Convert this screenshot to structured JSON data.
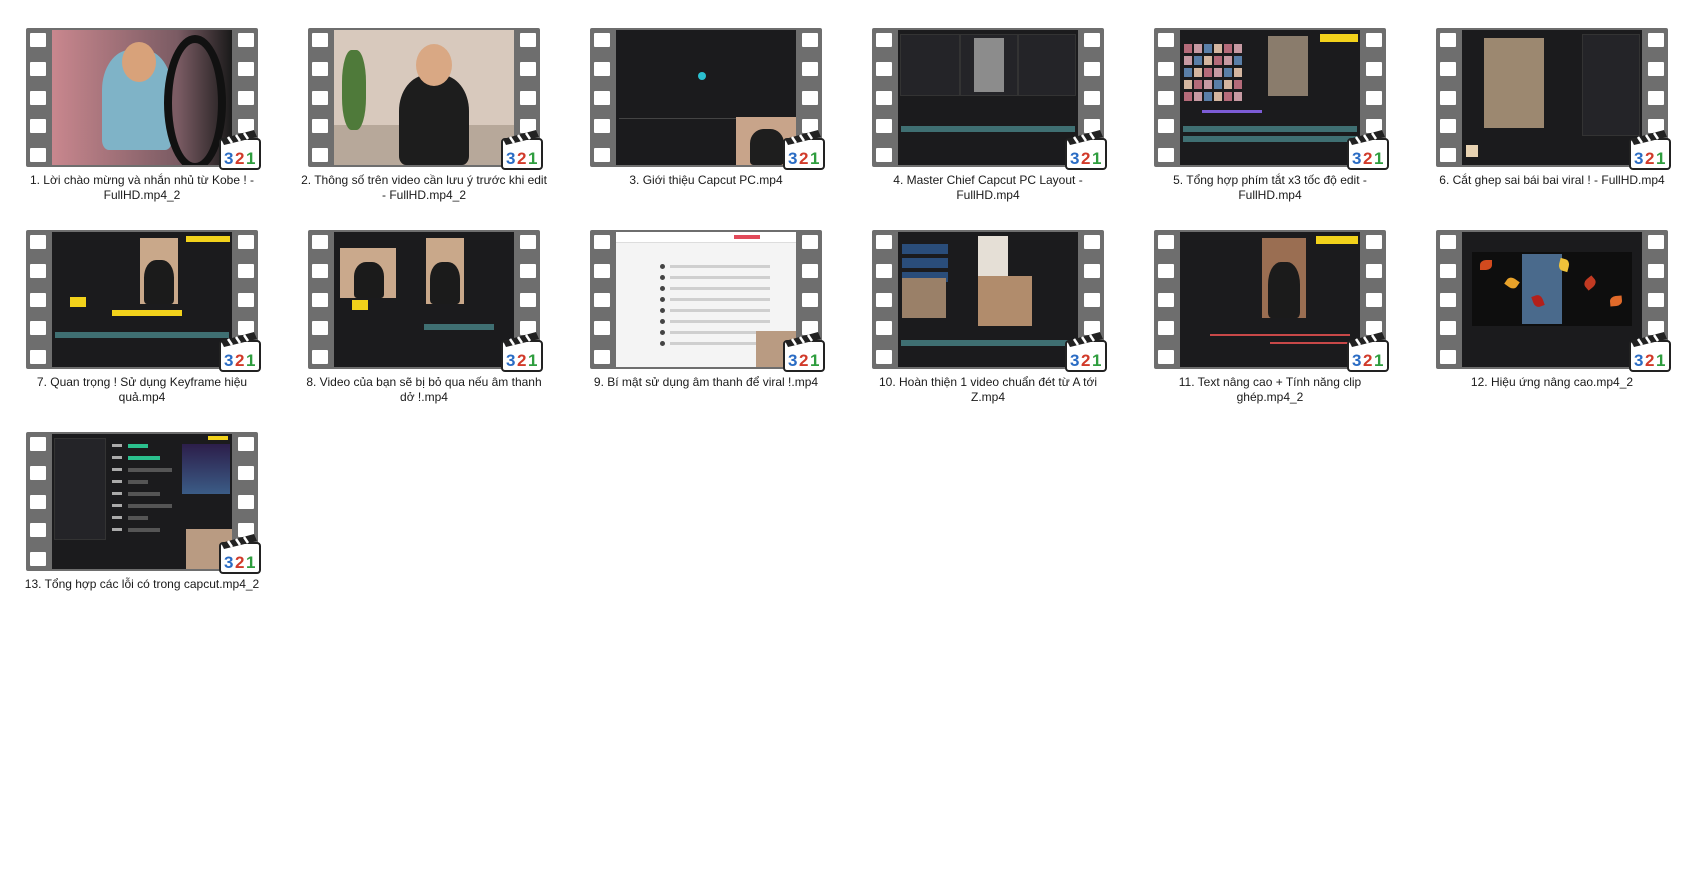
{
  "files": [
    {
      "name": "1. Lời chào mừng và nhắn nhủ từ Kobe ! - FullHD.mp4_2",
      "thumb": "vlog-pink",
      "badge": "321"
    },
    {
      "name": "2. Thông số trên video cần lưu ý trước khi edit - FullHD.mp4_2",
      "thumb": "vlog-room",
      "badge": "321"
    },
    {
      "name": "3. Giới thiệu Capcut PC.mp4",
      "thumb": "editor-empty",
      "badge": "321"
    },
    {
      "name": "4. Master Chief Capcut PC Layout - FullHD.mp4",
      "thumb": "editor-layout",
      "badge": "321"
    },
    {
      "name": "5. Tổng hợp phím tắt x3 tốc độ edit -FullHD.mp4",
      "thumb": "editor-grid",
      "badge": "321"
    },
    {
      "name": "6. Cắt ghep sai bái bai viral ! - FullHD.mp4",
      "thumb": "editor-crop",
      "badge": "321"
    },
    {
      "name": "7. Quan trọng ! Sử dụng Keyframe hiệu quả.mp4",
      "thumb": "editor-keyframe",
      "badge": "321"
    },
    {
      "name": "8. Video của bạn sẽ bị bỏ qua nếu âm thanh dở !.mp4",
      "thumb": "editor-two",
      "badge": "321"
    },
    {
      "name": "9. Bí mật sử dụng âm thanh để viral !.mp4",
      "thumb": "web-list",
      "badge": "321"
    },
    {
      "name": "10. Hoàn thiện 1 video chuẩn đét từ A tới Z.mp4",
      "thumb": "editor-full",
      "badge": "321"
    },
    {
      "name": "11. Text nâng cao + Tính năng clip ghép.mp4_2",
      "thumb": "editor-text",
      "badge": "321"
    },
    {
      "name": "12. Hiệu ứng nâng cao.mp4_2",
      "thumb": "editor-leaves",
      "badge": "321"
    },
    {
      "name": "13. Tổng hợp các lỗi có trong capcut.mp4_2",
      "thumb": "settings-dialog",
      "badge": "321"
    }
  ],
  "colors": {
    "film": "#6e6e6e",
    "screen": "#1b1b1d",
    "logo_green": "#2e9d3e",
    "logo_red": "#d13a2a",
    "logo_blue": "#2a6cc4"
  }
}
